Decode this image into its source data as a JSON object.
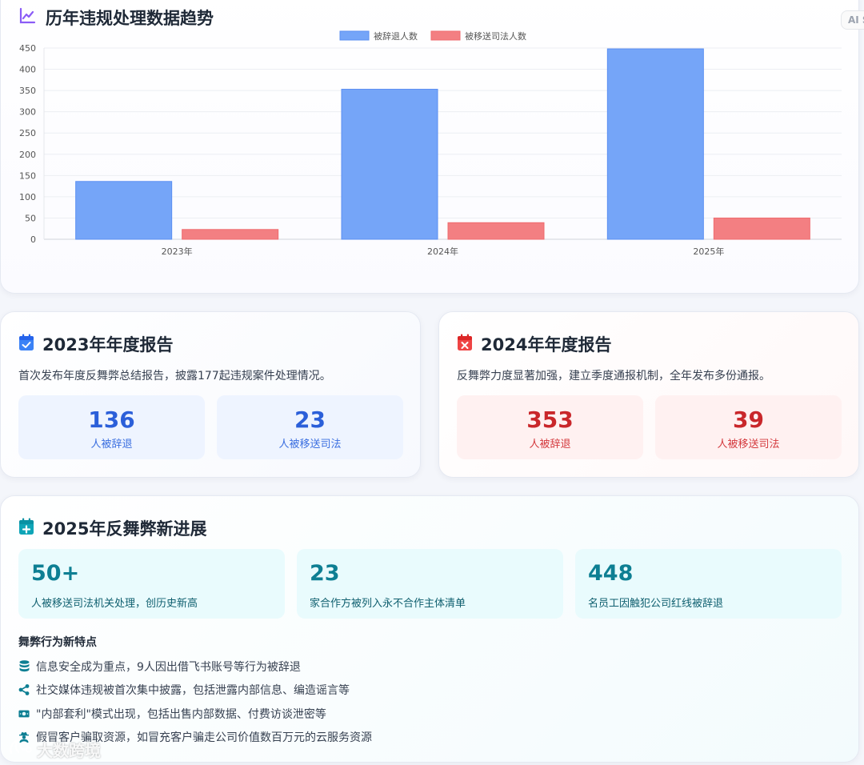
{
  "chart_section": {
    "title": "历年违规处理数据趋势",
    "ai_badge": "AI S"
  },
  "chart_data": {
    "type": "bar",
    "categories": [
      "2023年",
      "2024年",
      "2025年"
    ],
    "series": [
      {
        "name": "被辞退人数",
        "values": [
          136,
          353,
          448
        ],
        "color": "#75a5f8"
      },
      {
        "name": "被移送司法人数",
        "values": [
          23,
          39,
          50
        ],
        "color": "#f37f82"
      }
    ],
    "ylim": [
      0,
      450
    ],
    "yticks": [
      0,
      50,
      100,
      150,
      200,
      250,
      300,
      350,
      400,
      450
    ],
    "ytick_labels": [
      "0",
      "50",
      "100",
      "150",
      "200",
      "250",
      "300",
      "350",
      "400",
      "450"
    ],
    "grid": true,
    "legend": "top-center"
  },
  "report_2023": {
    "title": "2023年年度报告",
    "desc": "首次发布年度反舞弊总结报告，披露177起违规案件处理情况。",
    "stat1_num": "136",
    "stat1_label": "人被辞退",
    "stat2_num": "23",
    "stat2_label": "人被移送司法"
  },
  "report_2024": {
    "title": "2024年年度报告",
    "desc": "反舞弊力度显著加强，建立季度通报机制，全年发布多份通报。",
    "stat1_num": "353",
    "stat1_label": "人被辞退",
    "stat2_num": "39",
    "stat2_label": "人被移送司法"
  },
  "progress_2025": {
    "title": "2025年反舞弊新进展",
    "boxes": [
      {
        "num": "50+",
        "label": "人被移送司法机关处理，创历史新高"
      },
      {
        "num": "23",
        "label": "家合作方被列入永不合作主体清单"
      },
      {
        "num": "448",
        "label": "名员工因触犯公司红线被辞退"
      }
    ],
    "features_title": "舞弊行为新特点",
    "features": [
      {
        "icon": "database-icon",
        "text": "信息安全成为重点，9人因出借飞书账号等行为被辞退"
      },
      {
        "icon": "share-icon",
        "text": "社交媒体违规被首次集中披露，包括泄露内部信息、编造谣言等"
      },
      {
        "icon": "money-icon",
        "text": "\"内部套利\"模式出现，包括出售内部数据、付费访谈泄密等"
      },
      {
        "icon": "user-secret-icon",
        "text": "假冒客户骗取资源，如冒充客户骗走公司价值数百万元的云服务资源"
      }
    ]
  },
  "watermark": "大数跨境",
  "colors": {
    "accent_purple": "#8b5cf6",
    "blue": "#2b5fd9",
    "red": "#c9272b",
    "teal": "#0e7f93"
  }
}
